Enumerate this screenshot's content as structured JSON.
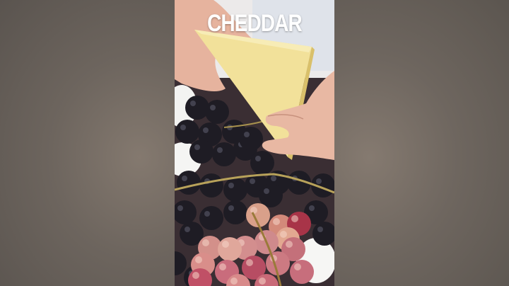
{
  "video": {
    "caption": "CHEDDAR"
  },
  "scene": {
    "subject": "cheese-wedge-over-grapes-platter",
    "colors": {
      "cheese": "#f2e29a",
      "dark_grape": "#1c1a22",
      "red_grape": "#c9767a",
      "burrata": "#f4f4f2",
      "hands": "#e9b8a4"
    }
  }
}
